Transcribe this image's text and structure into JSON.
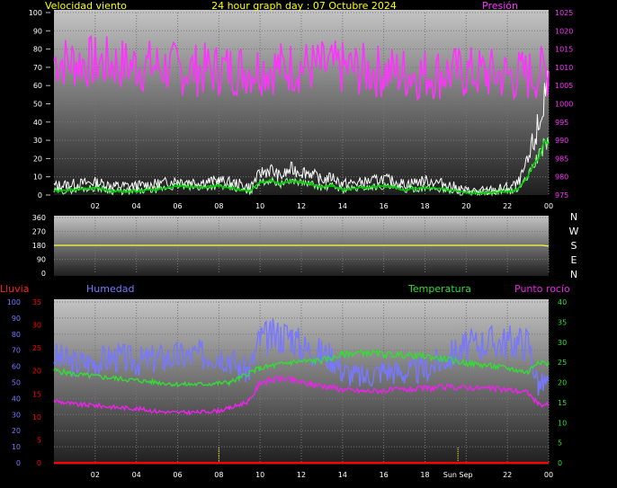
{
  "header": {
    "title": "24 hour graph day : 07 Octubre 2024",
    "wind_label": "Velocidad viento",
    "pressure_label": "Presión"
  },
  "compass": [
    "N",
    "W",
    "S",
    "E",
    "N"
  ],
  "bottom_labels": {
    "rain": "Lluvia",
    "humidity": "Humedad",
    "temperature": "Temperatura",
    "dewpoint": "Punto rocío"
  },
  "colors": {
    "title": "#ffff00",
    "pressure": "#ff33ff",
    "wind_avg": "#00cc00",
    "wind_gust": "#ffffff",
    "wind_mid": "#99ff99",
    "direction": "#ffff33",
    "rain": "#ff0000",
    "humidity": "#7777ff",
    "temperature": "#33dd33",
    "dewpoint": "#ee22ee"
  },
  "chart_data": [
    {
      "type": "line",
      "x_ticks": [
        "02",
        "04",
        "06",
        "08",
        "10",
        "12",
        "14",
        "16",
        "18",
        "20",
        "22",
        "00"
      ],
      "y_left_ticks": [
        0,
        10,
        20,
        30,
        40,
        50,
        60,
        70,
        80,
        90,
        100
      ],
      "y_right_ticks": [
        975,
        980,
        985,
        990,
        995,
        1000,
        1005,
        1010,
        1015,
        1020,
        1025
      ],
      "ylim_left": [
        0,
        100
      ],
      "ylim_right": [
        975,
        1025
      ],
      "xlim": [
        0,
        24
      ],
      "series": [
        {
          "name": "Velocidad viento",
          "axis": "left",
          "kind": "wind_gust",
          "x": [
            0,
            1,
            2,
            3,
            4,
            5,
            6,
            7,
            8,
            9,
            9.5,
            10,
            10.5,
            11,
            11.5,
            12,
            12.5,
            13,
            13.5,
            14,
            15,
            16,
            17,
            18,
            19,
            20,
            21,
            22,
            22.5,
            23,
            23.3,
            23.6,
            23.8,
            24
          ],
          "y": [
            5,
            6,
            7,
            5,
            5,
            6,
            8,
            7,
            8,
            6,
            4,
            12,
            14,
            10,
            14,
            13,
            12,
            8,
            10,
            6,
            7,
            9,
            6,
            8,
            6,
            2,
            2,
            4,
            6,
            18,
            30,
            40,
            55,
            60
          ]
        },
        {
          "name": "Velocidad viento",
          "axis": "left",
          "kind": "wind_avg",
          "x": [
            0,
            1,
            2,
            3,
            4,
            5,
            6,
            7,
            8,
            9,
            9.5,
            10,
            10.5,
            11,
            11.5,
            12,
            12.5,
            13,
            13.5,
            14,
            15,
            16,
            17,
            18,
            19,
            20,
            21,
            22,
            22.5,
            23,
            23.3,
            23.6,
            23.8,
            24
          ],
          "y": [
            2,
            3,
            4,
            2,
            2,
            3,
            5,
            4,
            5,
            3,
            2,
            7,
            8,
            6,
            8,
            7,
            6,
            4,
            5,
            3,
            4,
            5,
            3,
            4,
            3,
            1,
            1,
            2,
            3,
            10,
            18,
            22,
            30,
            28
          ]
        },
        {
          "name": "Presión",
          "axis": "right",
          "kind": "pressure",
          "x": [
            0,
            1,
            2,
            3,
            4,
            5,
            6,
            7,
            8,
            9,
            10,
            11,
            12,
            13,
            14,
            15,
            16,
            17,
            18,
            19,
            20,
            21,
            22,
            23,
            24
          ],
          "y": [
            1012,
            1011.5,
            1011.3,
            1011,
            1010.5,
            1010.3,
            1009.5,
            1009.3,
            1009.5,
            1009.5,
            1009.8,
            1010,
            1010.2,
            1010,
            1009.8,
            1009.3,
            1008.8,
            1008.5,
            1008.3,
            1008.5,
            1008.5,
            1008.2,
            1007.8,
            1007.8,
            1009
          ]
        }
      ]
    },
    {
      "type": "line",
      "y_ticks": [
        0,
        90,
        180,
        270,
        360
      ],
      "ylim": [
        0,
        360
      ],
      "xlim": [
        0,
        24
      ],
      "series": [
        {
          "kind": "direction",
          "x": [
            0,
            6,
            12,
            18,
            23.7,
            24
          ],
          "y": [
            180,
            180,
            180,
            180,
            180,
            175
          ]
        }
      ]
    },
    {
      "type": "line",
      "x_ticks": [
        "02",
        "04",
        "06",
        "08",
        "10",
        "12",
        "14",
        "16",
        "18",
        "20",
        "22",
        "00"
      ],
      "x_annotation": "Sun Sep",
      "y_rain_ticks": [
        0,
        5,
        10,
        15,
        20,
        25,
        30,
        35
      ],
      "y_hum_ticks": [
        0,
        10,
        20,
        30,
        40,
        50,
        60,
        70,
        80,
        90,
        100
      ],
      "y_temp_ticks": [
        0,
        5,
        10,
        15,
        20,
        25,
        30,
        35,
        40
      ],
      "ylim_rain": [
        0,
        35
      ],
      "ylim_hum": [
        0,
        100
      ],
      "ylim_temp": [
        0,
        40
      ],
      "xlim": [
        0,
        24
      ],
      "series": [
        {
          "name": "Humedad",
          "axis": "hum",
          "kind": "humidity",
          "x": [
            0,
            1,
            2,
            3,
            4,
            5,
            6,
            7,
            8,
            8.5,
            9,
            9.5,
            10,
            10.5,
            11,
            11.5,
            12,
            12.5,
            13,
            13.5,
            14,
            15,
            16,
            17,
            18,
            19,
            20,
            21,
            22,
            23,
            23.5,
            24
          ],
          "y": [
            66,
            62,
            63,
            66,
            63,
            65,
            66,
            67,
            68,
            66,
            58,
            58,
            77,
            78,
            79,
            80,
            72,
            70,
            68,
            66,
            57,
            53,
            58,
            56,
            58,
            65,
            72,
            75,
            75,
            75,
            48,
            51
          ]
        },
        {
          "name": "Temperatura",
          "axis": "temp",
          "kind": "temperature",
          "x": [
            0,
            1,
            2,
            3,
            4,
            5,
            6,
            7,
            8,
            8.5,
            9,
            9.5,
            10,
            10.5,
            11,
            11.5,
            12,
            12.5,
            13,
            13.5,
            14,
            15,
            16,
            17,
            18,
            19,
            20,
            21,
            22,
            23,
            23.5,
            24
          ],
          "y": [
            23,
            22,
            21.5,
            21,
            20.5,
            20,
            19.5,
            19.5,
            19.8,
            20,
            21,
            22.5,
            23.5,
            24,
            24.5,
            25,
            25.2,
            25.3,
            25.5,
            26,
            27,
            27.5,
            27,
            26.8,
            26.5,
            25.8,
            24.8,
            24.2,
            23.5,
            22.5,
            25.5,
            24.5
          ]
        },
        {
          "name": "Punto rocío",
          "axis": "temp",
          "kind": "dewpoint",
          "x": [
            0,
            1,
            2,
            3,
            4,
            5,
            6,
            7,
            8,
            8.5,
            9,
            9.5,
            10,
            10.5,
            11,
            11.5,
            12,
            12.5,
            13,
            13.5,
            14,
            15,
            16,
            17,
            18,
            19,
            20,
            21,
            22,
            23,
            23.5,
            24
          ],
          "y": [
            15.5,
            14.5,
            14.3,
            13.8,
            13.5,
            12.8,
            12.5,
            12.6,
            13,
            13.5,
            14.5,
            15.5,
            20,
            20.5,
            21,
            20.5,
            20,
            19.5,
            19.2,
            18.8,
            18.2,
            17.8,
            18,
            18.2,
            18.5,
            18.8,
            18.8,
            18.5,
            18.2,
            17.5,
            14.5,
            14.5
          ]
        },
        {
          "name": "Lluvia",
          "axis": "rain",
          "kind": "rain",
          "x": [
            0,
            24
          ],
          "y": [
            0,
            0
          ]
        }
      ]
    }
  ]
}
